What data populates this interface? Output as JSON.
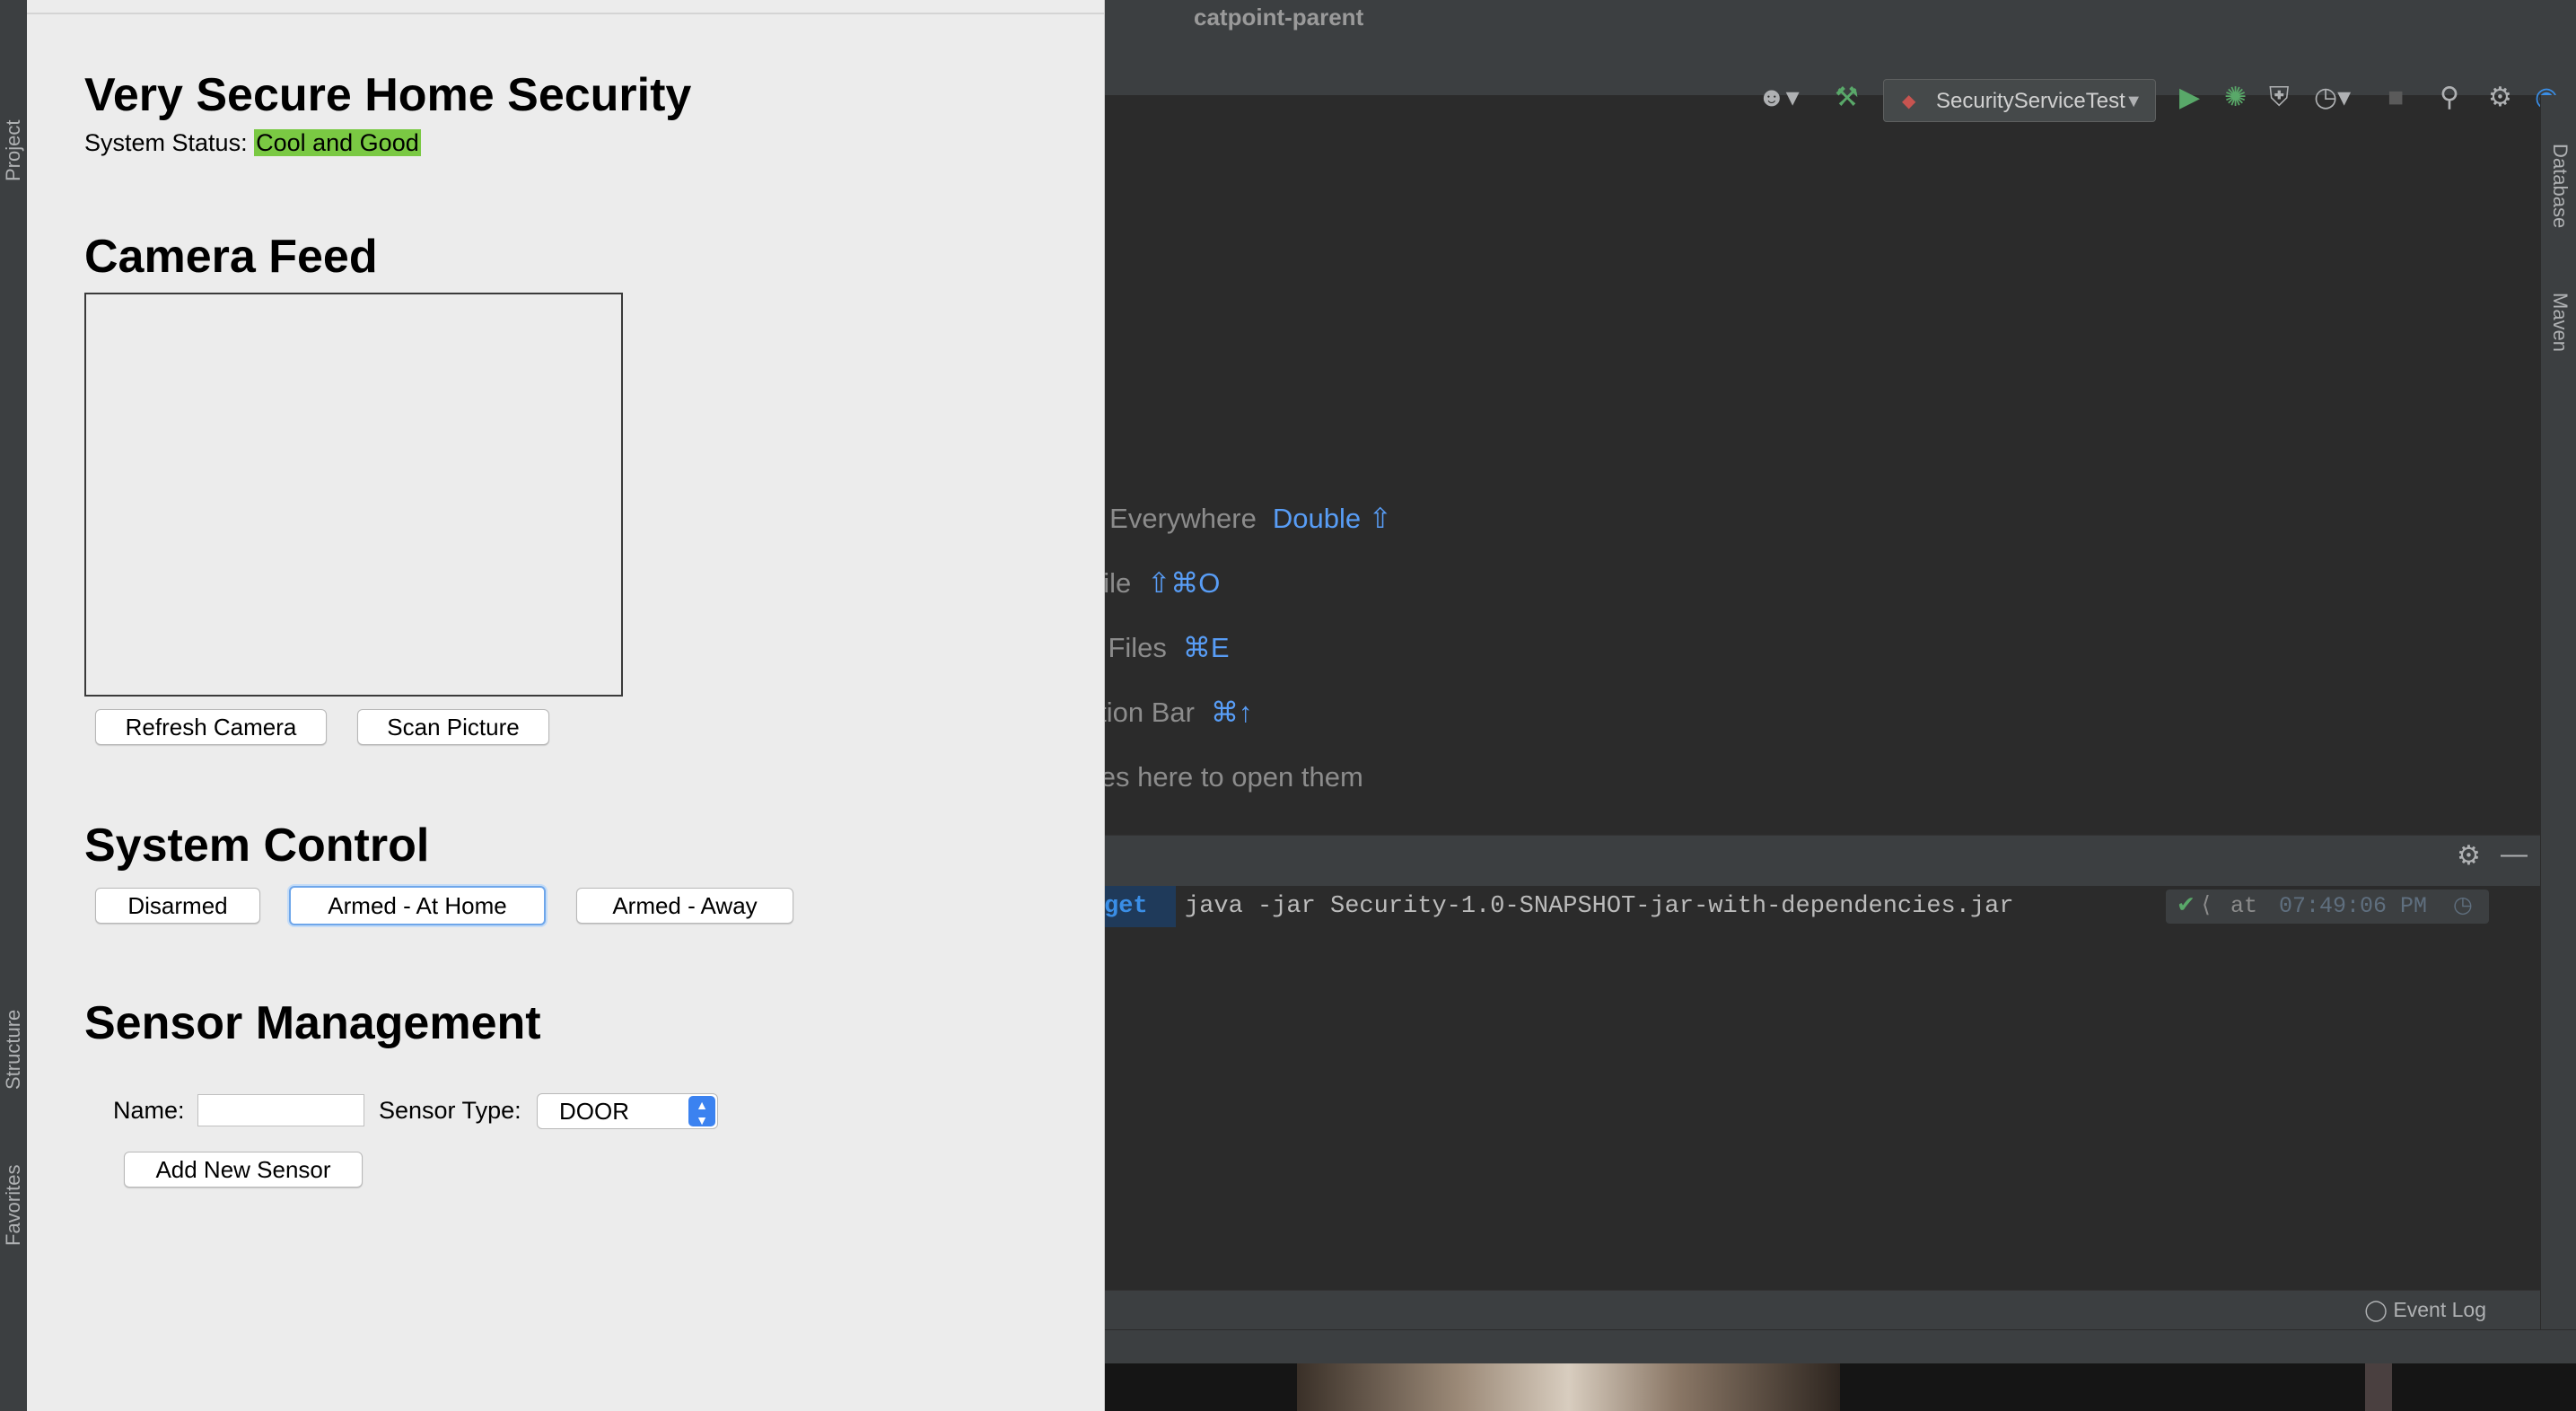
{
  "ide": {
    "window_title": "catpoint-parent",
    "run_config": "SecurityServiceTest",
    "left_tabs": [
      "Project",
      "Structure",
      "Favorites"
    ],
    "right_tabs": [
      "Database",
      "Maven"
    ],
    "welcome_hints": [
      {
        "label": "earch Everywhere",
        "shortcut": "Double ⇧"
      },
      {
        "label": "o to File",
        "shortcut": "⇧⌘O"
      },
      {
        "label": "ecent Files",
        "shortcut": "⌘E"
      },
      {
        "label": "avigation Bar",
        "shortcut": "⌘↑"
      },
      {
        "label": "rop files here to open them",
        "shortcut": ""
      }
    ],
    "terminal": {
      "prompt": "get",
      "command": "java -jar Security-1.0-SNAPSHOT-jar-with-dependencies.jar",
      "status_at": "at",
      "status_time": "07:49:06 PM"
    },
    "event_log": "Event Log",
    "icons": {
      "user": "user-icon",
      "build": "hammer-icon",
      "run": "run-icon",
      "debug": "debug-icon",
      "coverage": "coverage-icon",
      "profile": "profile-icon",
      "stop": "stop-icon",
      "search": "search-icon",
      "settings": "gear-icon"
    },
    "colors": {
      "background": "#2b2b2b",
      "panel": "#3c3f41",
      "accent": "#589df6",
      "run_green": "#59a869"
    }
  },
  "app": {
    "title": "Very Secure Home Security",
    "status_label": "System Status:",
    "status_value": "Cool and Good",
    "status_color": "#7ac943",
    "camera": {
      "heading": "Camera Feed",
      "refresh_label": "Refresh Camera",
      "scan_label": "Scan Picture"
    },
    "control": {
      "heading": "System Control",
      "buttons": [
        "Disarmed",
        "Armed - At Home",
        "Armed - Away"
      ],
      "focused_button": "Armed - At Home"
    },
    "sensors": {
      "heading": "Sensor Management",
      "name_label": "Name:",
      "name_value": "",
      "type_label": "Sensor Type:",
      "type_value": "DOOR",
      "add_label": "Add New Sensor"
    }
  }
}
